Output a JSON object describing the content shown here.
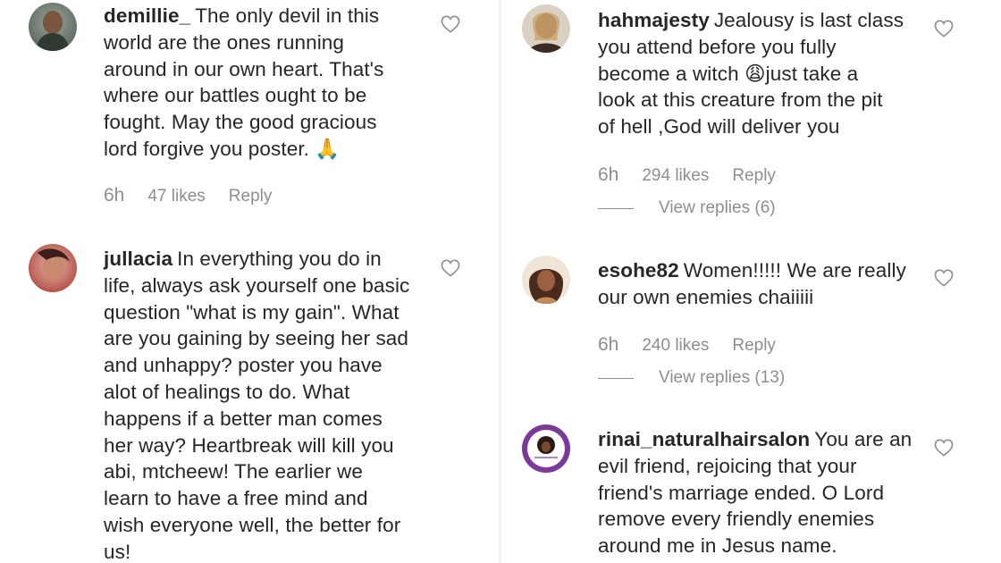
{
  "comments_left": [
    {
      "username": "demillie_",
      "lines": [
        "The only devil in this",
        "world are the ones running",
        "around in our own heart. That's",
        "where our battles ought to be",
        "fought. May the good gracious",
        "lord forgive you poster. 🙏"
      ],
      "time": "6h",
      "likes": "47 likes",
      "reply_label": "Reply"
    },
    {
      "username": "jullacia",
      "lines": [
        "In everything you do in",
        "life, always ask yourself one basic",
        "question \"what is my gain\". What",
        "are you gaining by seeing her sad",
        "and unhappy? poster you have",
        "alot of healings to do. What",
        "happens if a better man comes",
        "her way? Heartbreak will kill you",
        "abi, mtcheew! The earlier we",
        "learn to have a free mind and",
        "wish everyone well, the better for",
        "us!"
      ]
    }
  ],
  "comments_right": [
    {
      "username": "hahmajesty",
      "lines": [
        "Jealousy is last class",
        "you attend before you fully",
        "become a witch 😩just take a",
        "look at this creature from the pit",
        "of hell ,God will deliver you"
      ],
      "time": "6h",
      "likes": "294 likes",
      "reply_label": "Reply",
      "view_replies": "View replies (6)"
    },
    {
      "username": "esohe82",
      "lines": [
        "Women!!!!! We are really",
        "our own enemies chaiiiii"
      ],
      "time": "6h",
      "likes": "240 likes",
      "reply_label": "Reply",
      "view_replies": "View replies (13)"
    },
    {
      "username": "rinai_naturalhairsalon",
      "lines": [
        "You are an",
        "evil friend, rejoicing that your",
        "friend's marriage ended. O Lord",
        "remove every friendly enemies",
        "around me in Jesus name."
      ]
    }
  ],
  "icons": {
    "like": "heart-outline-icon",
    "avatar": "profile-photo"
  },
  "colors": {
    "text": "#262626",
    "meta": "#8e8e8e",
    "background": "#ffffff"
  }
}
